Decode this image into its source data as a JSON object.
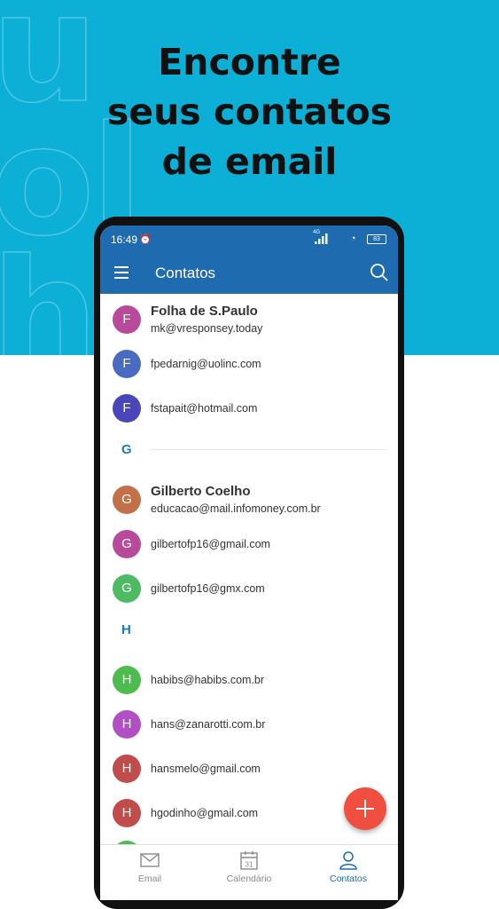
{
  "headline": {
    "line1": "Encontre",
    "line2": "seus contatos",
    "line3": "de email"
  },
  "background_text": "uolhost",
  "status_bar": {
    "time": "16:49",
    "network": "4G",
    "battery": "83"
  },
  "app_bar": {
    "title": "Contatos",
    "menu_icon": "hamburger-menu-icon",
    "search_icon": "search-icon"
  },
  "contacts": [
    {
      "initial": "F",
      "name": "Folha de S.Paulo",
      "email": "mk@vresponsey.today",
      "color": "#b84a9c"
    },
    {
      "initial": "F",
      "name": "",
      "email": "fpedarnig@uolinc.com",
      "color": "#4a6cc0"
    },
    {
      "initial": "F",
      "name": "",
      "email": "fstapait@hotmail.com",
      "color": "#4a45b8"
    },
    {
      "initial": "G",
      "name": "Gilberto Coelho",
      "email": "educacao@mail.infomoney.com.br",
      "color": "#c27048"
    },
    {
      "initial": "G",
      "name": "",
      "email": "gilbertofp16@gmail.com",
      "color": "#b84a9c"
    },
    {
      "initial": "G",
      "name": "",
      "email": "gilbertofp16@gmx.com",
      "color": "#4dbb63"
    },
    {
      "initial": "H",
      "name": "",
      "email": "habibs@habibs.com.br",
      "color": "#4dbb4d"
    },
    {
      "initial": "H",
      "name": "",
      "email": "hans@zanarotti.com.br",
      "color": "#b24fc2"
    },
    {
      "initial": "H",
      "name": "",
      "email": "hansmelo@gmail.com",
      "color": "#c04c4c"
    },
    {
      "initial": "H",
      "name": "",
      "email": "hgodinho@gmail.com",
      "color": "#c04c4c"
    }
  ],
  "sections": [
    "G",
    "H"
  ],
  "bottom_nav": [
    {
      "label": "Email",
      "icon": "envelope-icon",
      "active": false
    },
    {
      "label": "Calendário",
      "icon": "calendar-icon",
      "active": false,
      "day": "31"
    },
    {
      "label": "Contatos",
      "icon": "person-icon",
      "active": true
    }
  ],
  "colors": {
    "hero": "#0cb0d6",
    "brand_blue": "#1e6bb0",
    "accent_blue": "#1e7bbf",
    "fab": "#f04e3e"
  }
}
